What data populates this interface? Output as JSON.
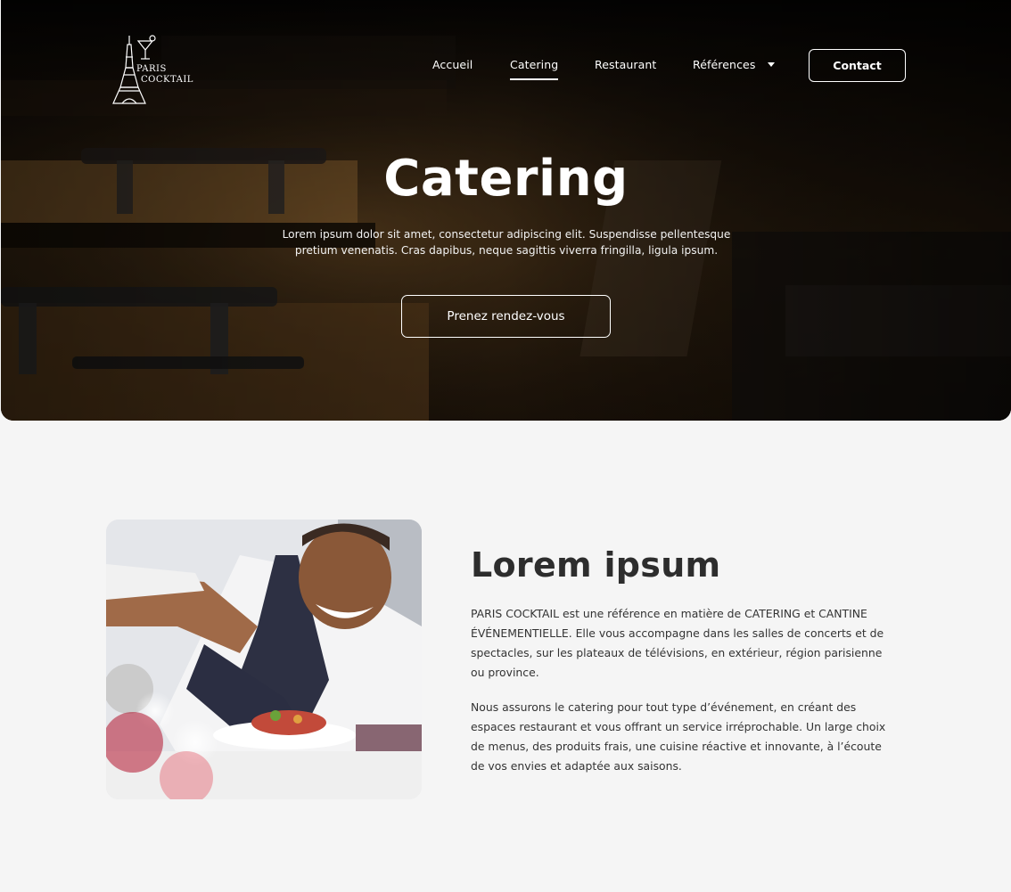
{
  "brand": {
    "logo_line1": "PARIS",
    "logo_line2": "COCKTAIL",
    "logo_icon": "eiffel-tower-cocktail-logo"
  },
  "nav": {
    "items": [
      {
        "label": "Accueil",
        "active": false
      },
      {
        "label": "Catering",
        "active": true
      },
      {
        "label": "Restaurant",
        "active": false
      },
      {
        "label": "Références",
        "active": false,
        "dropdown": true
      }
    ],
    "contact_label": "Contact",
    "dropdown_icon": "caret-down-icon"
  },
  "hero": {
    "title": "Catering",
    "subtitle": "Lorem ipsum dolor sit amet, consectetur adipiscing elit. Suspendisse pellentesque pretium venenatis. Cras dapibus, neque sagittis viverra fringilla, ligula ipsum.",
    "cta_label": "Prenez rendez-vous"
  },
  "about": {
    "title": "Lorem ipsum",
    "paragraph1": "PARIS COCKTAIL est une référence en matière de CATERING et CANTINE ÉVÉNEMENTIELLE. Elle vous accompagne dans les salles de concerts et de spectacles, sur les plateaux de télévisions, en extérieur, région parisienne ou province.",
    "paragraph2": "Nous assurons le catering pour tout type d’événement, en créant des espaces restaurant et vous offrant un service irréprochable. Un large choix de menus, des produits frais, une cuisine réactive et innovante, à l’écoute de vos envies et adaptée aux saisons."
  },
  "colors": {
    "page_bg": "#f5f5f5",
    "hero_bg": "#0a0806",
    "heading": "#2d2d2d",
    "text": "#333333",
    "on_dark": "#ffffff"
  }
}
